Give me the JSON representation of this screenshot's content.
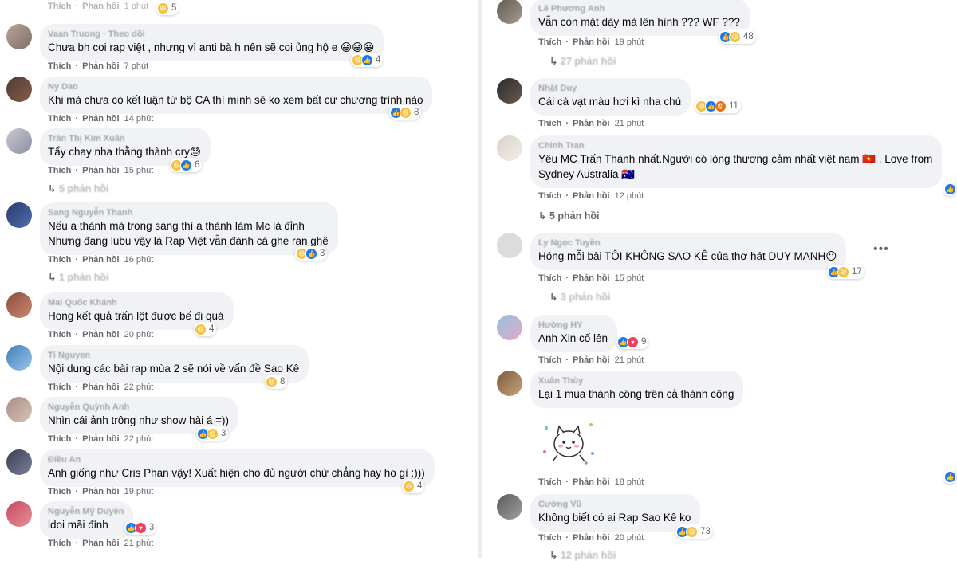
{
  "left": [
    {
      "id": "c0",
      "name": "",
      "text": "",
      "actions": {
        "like": "Thích",
        "reply": "Phản hồi",
        "time": "1 phút"
      },
      "reactions": {
        "types": [
          "haha"
        ],
        "count": "5"
      }
    },
    {
      "id": "c1",
      "name": "Vaan Truong · Theo dõi",
      "text": "Chưa bh coi rap việt , nhưng vì anti bà h nên sẽ coi ủng hộ e 😀😀😀",
      "actions": {
        "like": "Thích",
        "reply": "Phản hồi",
        "time": "7 phút"
      },
      "reactions": {
        "types": [
          "haha",
          "like"
        ],
        "count": "4"
      }
    },
    {
      "id": "c2",
      "name": "Ny Dao",
      "text": "Khi mà chưa có kết luận từ bộ CA thì mình sẽ ko xem bất cứ chương trình nào",
      "actions": {
        "like": "Thích",
        "reply": "Phản hồi",
        "time": "14 phút"
      },
      "reactions": {
        "types": [
          "like",
          "haha"
        ],
        "count": "8"
      }
    },
    {
      "id": "c3",
      "name": "Trần Thị Kim Xuân",
      "text": "Tẩy chay nha thằng thành cry😓",
      "actions": {
        "like": "Thích",
        "reply": "Phản hồi",
        "time": "15 phút"
      },
      "reactions": {
        "types": [
          "haha",
          "like"
        ],
        "count": "6"
      },
      "replies": "5 phản hồi"
    },
    {
      "id": "c4",
      "name": "Sang Nguyễn Thanh",
      "text": "Nếu a thành mà trong sáng thì a thành làm Mc là đỉnh",
      "text2": "Nhưng đang lubu vậy là Rap Việt vẫn đánh cá ghé ran ghê",
      "actions": {
        "like": "Thích",
        "reply": "Phản hồi",
        "time": "16 phút"
      },
      "reactions": {
        "types": [
          "haha",
          "like"
        ],
        "count": "3"
      },
      "replies": "1 phản hồi"
    },
    {
      "id": "c5",
      "name": "Mai Quốc Khánh",
      "text": "Hong kết quả trấn lột được bế đi quá",
      "actions": {
        "like": "Thích",
        "reply": "Phản hồi",
        "time": "20 phút"
      },
      "reactions": {
        "types": [
          "haha"
        ],
        "count": "4"
      }
    },
    {
      "id": "c6",
      "name": "Tí Nguyen",
      "text": "Nội dung các bài rap mùa 2 sẽ nói về vấn đề Sao Kê",
      "actions": {
        "like": "Thích",
        "reply": "Phản hồi",
        "time": "22 phút"
      },
      "reactions": {
        "types": [
          "haha"
        ],
        "count": "8"
      }
    },
    {
      "id": "c7",
      "name": "Nguyễn Quỳnh Anh",
      "text": "Nhìn cái ảnh trông như show hài á =))",
      "actions": {
        "like": "Thích",
        "reply": "Phản hồi",
        "time": "22 phút"
      },
      "reactions": {
        "types": [
          "like",
          "haha"
        ],
        "count": "3"
      }
    },
    {
      "id": "c8",
      "name": "Điều An",
      "text": "Anh giống như Cris Phan vậy! Xuất hiện cho đủ người chứ chẳng hay ho gì :)))",
      "actions": {
        "like": "Thích",
        "reply": "Phản hồi",
        "time": "19 phút"
      },
      "reactions": {
        "types": [
          "haha"
        ],
        "count": "4"
      }
    },
    {
      "id": "c9",
      "name": "Nguyễn Mỹ Duyên",
      "text": "ldoi mãi đỉnh",
      "actions": {
        "like": "Thích",
        "reply": "Phản hồi",
        "time": "21 phút"
      },
      "reactions": {
        "types": [
          "like",
          "love"
        ],
        "count": "3"
      }
    }
  ],
  "right": [
    {
      "id": "d0",
      "name": "Lê Phương Anh",
      "text": "Vẫn còn mặt dày mà lên hình ??? WF ???",
      "actions": {
        "like": "Thích",
        "reply": "Phản hồi",
        "time": "19 phút"
      },
      "reactions": {
        "types": [
          "like",
          "haha"
        ],
        "count": "48"
      },
      "replies": "27 phản hồi"
    },
    {
      "id": "d1",
      "name": "Nhật Duy",
      "text": "Cái cà vạt màu hơi kì nha chú",
      "actions": {
        "like": "Thích",
        "reply": "Phản hồi",
        "time": "21 phút"
      },
      "reactions": {
        "types": [
          "haha",
          "like",
          "angry"
        ],
        "count": "11"
      }
    },
    {
      "id": "d2",
      "name": "Chinh Tran",
      "text": "Yêu MC Trấn Thành nhất.Người có lòng thương cảm nhất việt nam 🇻🇳 . Love from",
      "text2": "Sydney Australia 🇦🇺",
      "actions": {
        "like": "Thích",
        "reply": "Phản hồi",
        "time": "12 phút"
      },
      "reactions": {
        "types": [
          "like"
        ],
        "count": ""
      },
      "replies": "5 phản hồi"
    },
    {
      "id": "d3",
      "name": "Ly Ngọc Tuyền",
      "text": "Hóng mỗi bài TÔI KHÔNG SAO KÊ của thợ hát DUY MẠNH😶",
      "actions": {
        "like": "Thích",
        "reply": "Phản hồi",
        "time": "15 phút"
      },
      "reactions": {
        "types": [
          "like",
          "haha"
        ],
        "count": "17"
      },
      "replies": "3 phản hồi",
      "more": "•••"
    },
    {
      "id": "d4",
      "name": "Hường HY",
      "text": "Anh Xin cố lên",
      "actions": {
        "like": "Thích",
        "reply": "Phản hồi",
        "time": "21 phút"
      },
      "reactions": {
        "types": [
          "like",
          "love"
        ],
        "count": "9"
      }
    },
    {
      "id": "d5",
      "name": "Xuân Thùy",
      "text": "Lại 1 mùa thành công trên cả thành công",
      "actions": {
        "like": "Thích",
        "reply": "Phản hồi",
        "time": "18 phút"
      },
      "reactions": {
        "types": [
          "like"
        ],
        "count": ""
      }
    },
    {
      "id": "d6",
      "name": "Cường Vũ",
      "text": "Không biết có ai Rap Sao Kê ko",
      "actions": {
        "like": "Thích",
        "reply": "Phản hồi",
        "time": "20 phút"
      },
      "reactions": {
        "types": [
          "like",
          "haha"
        ],
        "count": "73"
      },
      "replies": "12 phản hồi"
    }
  ],
  "colors": {
    "bubble": "#f0f2f5",
    "meta": "#65676b",
    "like": "#1877f2",
    "haha": "#f7c13d",
    "love": "#f33e58",
    "angry": "#e9710f"
  }
}
